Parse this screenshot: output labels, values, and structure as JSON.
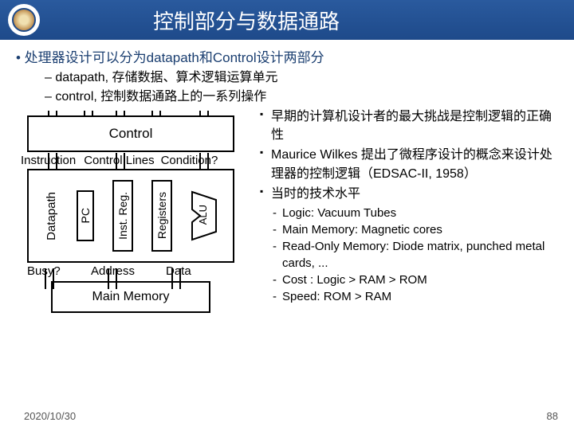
{
  "header": {
    "title": "控制部分与数据通路"
  },
  "intro": {
    "main": "•  处理器设计可以分为datapath和Control设计两部分",
    "sub1": "–  datapath, 存储数据、算术逻辑运算单元",
    "sub2": "–  control, 控制数据通路上的一系列操作"
  },
  "diagram": {
    "control": "Control",
    "io_instruction": "Instruction",
    "io_ctrl_lines": "Control Lines",
    "io_condition": "Condition?",
    "datapath_label": "Datapath",
    "pc": "PC",
    "instreg": "Inst. Reg.",
    "registers": "Registers",
    "alu": "ALU",
    "busy": "Busy?",
    "address": "Address",
    "data": "Data",
    "main_memory": "Main Memory"
  },
  "right": {
    "b1": "早期的计算机设计者的最大挑战是控制逻辑的正确性",
    "b2": "Maurice Wilkes 提出了微程序设计的概念来设计处理器的控制逻辑（EDSAC-II, 1958）",
    "b3": "当时的技术水平",
    "s1": "Logic: Vacuum Tubes",
    "s2": "Main Memory: Magnetic cores",
    "s3": "Read-Only Memory: Diode matrix, punched metal cards, ...",
    "s4": "Cost :   Logic > RAM > ROM",
    "s5": "Speed: ROM > RAM"
  },
  "footer": {
    "date": "2020/10/30",
    "page": "88"
  }
}
